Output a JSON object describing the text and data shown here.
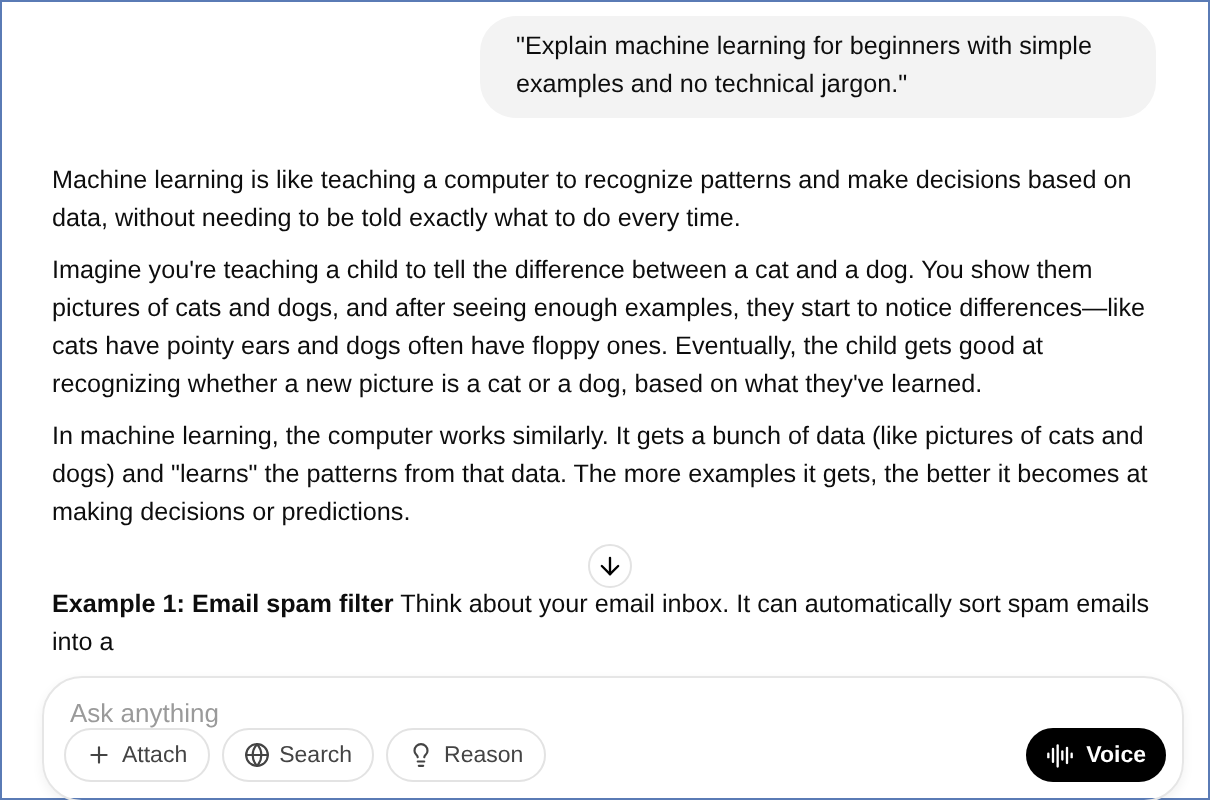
{
  "user_message": "\"Explain machine learning for beginners with simple examples and no technical jargon.\"",
  "response": [
    "Machine learning is like teaching a computer to recognize patterns and make decisions based on data, without needing to be told exactly what to do every time.",
    "Imagine you're teaching a child to tell the difference between a cat and a dog. You show them pictures of cats and dogs, and after seeing enough examples, they start to notice differences—like cats have pointy ears and dogs often have floppy ones. Eventually, the child gets good at recognizing whether a new picture is a cat or a dog, based on what they've learned.",
    "In machine learning, the computer works similarly. It gets a bunch of data (like pictures of cats and dogs) and \"learns\" the patterns from that data. The more examples it gets, the better it becomes at making decisions or predictions.",
    "**Example 1: Email spam filter** Think about your email inbox. It can automatically sort spam emails into a"
  ],
  "composer": {
    "placeholder": "Ask anything",
    "tools": [
      {
        "kind": "attach",
        "label": "Attach"
      },
      {
        "kind": "search",
        "label": "Search"
      },
      {
        "kind": "reason",
        "label": "Reason"
      }
    ],
    "voice_button": "Voice"
  }
}
